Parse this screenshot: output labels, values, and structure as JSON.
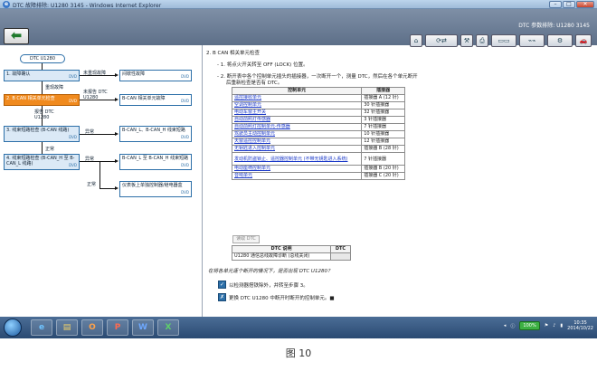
{
  "window": {
    "title": "DTC 故障排除: U1280 3145 - Windows Internet Explorer"
  },
  "app": {
    "header_title": "DTC 参数排除: U1280 3145",
    "back_icon": "back-arrow-icon",
    "toolbar_icons": [
      "home-icon",
      "refresh-icon",
      "tool-icon",
      "print-icon",
      "arrow-icon",
      "scanner-icon",
      "tool2-icon",
      "cable-icon",
      "car-icon"
    ]
  },
  "flow": {
    "start": "DTC U1280",
    "step1": "故障确认",
    "step1_dvd": "DVD",
    "step1_branch_label": "未重现故障",
    "step1_branch_box": "间歇性故障",
    "step1_branch_dvd": "DVD",
    "step1_down_label": "重现故障",
    "step2": "B CAN 相关单元检查",
    "step2_dvd": "DVD",
    "step2_branch_label": "未报告 DTC U1280",
    "step2_branch_box": "B-CAN 相关单元故障",
    "step2_branch_dvd": "DVD",
    "step2_down_label": "报告 DTC U1280",
    "step3": "线束短路检查 (B-CAN 线路)",
    "step3_dvd": "DVD",
    "step3_branch_label": "异常",
    "step3_branch_box": "B-CAN_L、B-CAN_H 线束短路",
    "step3_branch_dvd": "DVD",
    "step3_down_label": "正常",
    "step4": "线束短路检查 (B-CAN_H 至 B-CAN_L 线路)",
    "step4_dvd": "DVD",
    "step4_branch_label": "异常",
    "step4_branch_box": "B-CAN_L 至 B-CAN_H 线束短路",
    "step4_branch_dvd": "DVD",
    "step4_normal_label": "正常",
    "step4_normal_box": "仪表板上单独控制器/继电器盒",
    "step4_normal_dvd": "DVD"
  },
  "content": {
    "section_title": "2. B CAN 相关单元检查",
    "item1": "- 1. 将点火开关转至 OFF (LOCK) 位置。",
    "item2a": "- 2. 断开表中各个控制单元插头的插接器，一次断开一个，测量 DTC，然后在各个单元断开",
    "item2b": "后重新检查是否有 DTC。",
    "table_headers": [
      "控制单元",
      "插接器"
    ],
    "table_rows": [
      [
        "遥控接收单元",
        "插接器 A (12 针)"
      ],
      [
        "空调控制单元",
        "30 针插接器"
      ],
      [
        "电动车窗主开关",
        "32 针插接器"
      ],
      [
        "自动前照灯传感器",
        "3 针插接器"
      ],
      [
        "自动前照灯控制单元-传感器",
        "7 针插接器"
      ],
      [
        "驾驶员主动控制单元",
        "10 针插接器"
      ],
      [
        "天窗遥控控制单元",
        "12 针插接器"
      ],
      [
        "无钥匙进入控制单元",
        "插接器 B (28 针)"
      ],
      [
        "发动机防盗锁止、遥控器控制单元 (不带无钥匙进入系统)",
        "7 针插接器"
      ],
      [
        "电动座椅控制单元",
        "插接器 B (20 针)"
      ],
      [
        "音响单元",
        "插接器 C (20 针)"
      ]
    ],
    "dtc_button": "读取 DTC",
    "dtc_headers": [
      "DTC 说明",
      "DTC"
    ],
    "dtc_row": [
      "U1280 通信总线故障诊断 (总线关闭)",
      ""
    ],
    "question": "在将各单元逐个断开的情况下，是否出现 DTC U1280？",
    "yes_text": "以检测器搭铁除外，并转至步骤 3。",
    "no_text": "更换 DTC U1280 中断开时断开的控制单元。■",
    "yes_icon": "yes-icon",
    "no_icon": "no-icon"
  },
  "taskbar": {
    "apps": [
      "ie-icon",
      "folder-icon",
      "office-icon",
      "powerpoint-icon",
      "word-icon",
      "excel-icon"
    ],
    "zoom": "100%",
    "time": "10:35",
    "date": "2014/10/22"
  },
  "caption": "图 10"
}
